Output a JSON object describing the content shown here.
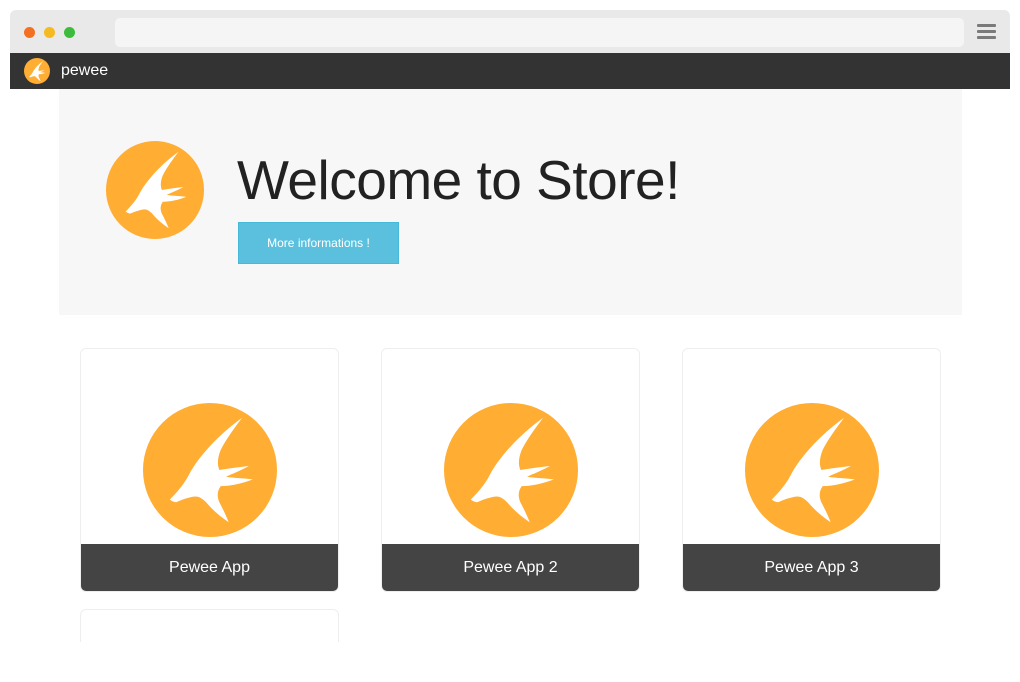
{
  "navbar": {
    "brand": "pewee",
    "logo_icon": "pewee-bird-icon"
  },
  "hero": {
    "title": "Welcome to Store!",
    "button_label": "More informations !",
    "logo_icon": "pewee-bird-icon"
  },
  "apps": [
    {
      "name": "Pewee App",
      "icon": "pewee-bird-icon"
    },
    {
      "name": "Pewee App 2",
      "icon": "pewee-bird-icon"
    },
    {
      "name": "Pewee App 3",
      "icon": "pewee-bird-icon"
    }
  ],
  "colors": {
    "brand_orange": "#ffad33",
    "navbar": "#333333",
    "info_button": "#5bc0de",
    "card_footer": "#444444"
  }
}
